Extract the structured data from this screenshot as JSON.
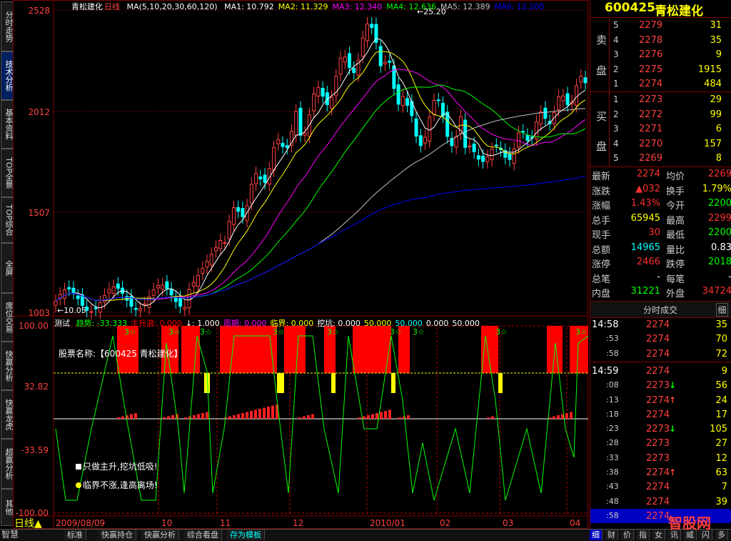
{
  "left_tabs": [
    {
      "label": "分时走势",
      "active": false
    },
    {
      "label": "技术分析",
      "active": true
    },
    {
      "label": "基本资料",
      "active": false
    },
    {
      "label": "TOP全景",
      "active": false
    },
    {
      "label": "TOP综合",
      "active": false
    },
    {
      "label": "全屏",
      "active": false
    },
    {
      "label": "席位交易",
      "active": false
    },
    {
      "label": "快赢分析",
      "active": false
    },
    {
      "label": "快赢龙虎",
      "active": false
    },
    {
      "label": "超赢分析",
      "active": false
    },
    {
      "label": "其他",
      "active": false
    }
  ],
  "main_chart": {
    "stock_name": "青松建化",
    "period": "日线",
    "ma_params": "MA(5,10,20,30,60,120)",
    "ma_values": [
      {
        "label": "MA1: 10.792",
        "color": "#ffffff"
      },
      {
        "label": "MA2: 11.329",
        "color": "#ffff00"
      },
      {
        "label": "MA3: 12.340",
        "color": "#ff00ff"
      },
      {
        "label": "MA4: 12.636",
        "color": "#00ff00"
      },
      {
        "label": "MA5: 12.389",
        "color": "#c0c0c0"
      },
      {
        "label": "MA6: 12.200",
        "color": "#0000ff"
      }
    ],
    "price_labels": [
      "2528",
      "2012",
      "1507",
      "1003"
    ],
    "peak_label": "25.20",
    "low_label": "10.05",
    "arrow_mark": "↓"
  },
  "indicator": {
    "name": "测试",
    "params": [
      {
        "text": "趋势: -33.333",
        "color": "#00ff00"
      },
      {
        "text": "主升浪: 0.000",
        "color": "#ff0000"
      },
      {
        "text": "↓: 1.000",
        "color": "#ffffff"
      },
      {
        "text": "周期: 0.000",
        "color": "#ff00ff"
      },
      {
        "text": "临界: 0.000",
        "color": "#ffff00"
      },
      {
        "text": "挖坑: 0.000",
        "color": "#ffffff"
      },
      {
        "text": "50.000",
        "color": "#ffff00"
      },
      {
        "text": "50.000",
        "color": "#00ffff"
      },
      {
        "text": "0.000",
        "color": "#ffffff"
      },
      {
        "text": "50.000",
        "color": "#ffffff"
      }
    ],
    "y_labels": [
      "100.00",
      "32.82",
      "-33.59",
      "-100.00"
    ],
    "stock_label": "股票名称:【600425 青松建化】",
    "note1": "只做主升,挖坑低吸!",
    "note2": "临界不涨,逢高离场!",
    "star": "3☆"
  },
  "x_axis": [
    "2009/08/09",
    "10",
    "11",
    "12",
    "2010/01",
    "02",
    "03",
    "04"
  ],
  "right_panel": {
    "code": "600425",
    "name": "青松建化",
    "sell_label": [
      "卖",
      "盘"
    ],
    "buy_label": [
      "买",
      "盘"
    ],
    "sell": [
      {
        "lvl": "5",
        "price": "2279",
        "vol": "31"
      },
      {
        "lvl": "4",
        "price": "2278",
        "vol": "35"
      },
      {
        "lvl": "3",
        "price": "2276",
        "vol": "9"
      },
      {
        "lvl": "2",
        "price": "2275",
        "vol": "1915"
      },
      {
        "lvl": "1",
        "price": "2274",
        "vol": "484"
      }
    ],
    "buy": [
      {
        "lvl": "1",
        "price": "2273",
        "vol": "29"
      },
      {
        "lvl": "2",
        "price": "2272",
        "vol": "99"
      },
      {
        "lvl": "3",
        "price": "2271",
        "vol": "6"
      },
      {
        "lvl": "4",
        "price": "2270",
        "vol": "157"
      },
      {
        "lvl": "5",
        "price": "2269",
        "vol": "8"
      }
    ],
    "quotes": [
      {
        "l1": "最新",
        "v1": "2274",
        "c1": "#ff3030",
        "l2": "均价",
        "v2": "2269",
        "c2": "#ff3030"
      },
      {
        "l1": "涨跌",
        "v1": "▲032",
        "c1": "#ff3030",
        "l2": "换手",
        "v2": "1.79%",
        "c2": "#ffff00"
      },
      {
        "l1": "涨幅",
        "v1": "1.43%",
        "c1": "#ff3030",
        "l2": "今开",
        "v2": "2200",
        "c2": "#00ff00"
      },
      {
        "l1": "总手",
        "v1": "65945",
        "c1": "#ffff00",
        "l2": "最高",
        "v2": "2299",
        "c2": "#ff3030"
      },
      {
        "l1": "现手",
        "v1": "30",
        "c1": "#ff3030",
        "l2": "最低",
        "v2": "2200",
        "c2": "#00ff00"
      },
      {
        "l1": "总额",
        "v1": "14965",
        "c1": "#00ffff",
        "l2": "量比",
        "v2": "0.83",
        "c2": "#ffffff"
      },
      {
        "l1": "涨停",
        "v1": "2466",
        "c1": "#ff3030",
        "l2": "跌停",
        "v2": "2018",
        "c2": "#00ff00"
      },
      {
        "l1": "总笔",
        "v1": "-",
        "c1": "#ffffff",
        "l2": "每笔",
        "v2": "-",
        "c2": "#ffffff"
      },
      {
        "l1": "内盘",
        "v1": "31221",
        "c1": "#00ff00",
        "l2": "外盘",
        "v2": "34724",
        "c2": "#ff3030"
      }
    ],
    "trades_title": "分时成交",
    "trades_tab": "细",
    "trades": [
      {
        "time": "14:58",
        "price": "2274",
        "arrow": "",
        "vol": "35"
      },
      {
        "time": ":53",
        "price": "2274",
        "arrow": "",
        "vol": "70"
      },
      {
        "time": ":58",
        "price": "2274",
        "arrow": "",
        "vol": "72"
      },
      {
        "time": "14:59",
        "price": "2274",
        "arrow": "",
        "vol": "9"
      },
      {
        "time": ":08",
        "price": "2273",
        "arrow": "↓",
        "vol": "56"
      },
      {
        "time": ":13",
        "price": "2274",
        "arrow": "↑",
        "vol": "24"
      },
      {
        "time": ":18",
        "price": "2274",
        "arrow": "",
        "vol": "17"
      },
      {
        "time": ":23",
        "price": "2273",
        "arrow": "↓",
        "vol": "105"
      },
      {
        "time": ":28",
        "price": "2273",
        "arrow": "",
        "vol": "27"
      },
      {
        "time": ":33",
        "price": "2273",
        "arrow": "",
        "vol": "12"
      },
      {
        "time": ":38",
        "price": "2274",
        "arrow": "↑",
        "vol": "63"
      },
      {
        "time": ":43",
        "price": "2274",
        "arrow": "",
        "vol": "7"
      },
      {
        "time": ":48",
        "price": "2274",
        "arrow": "",
        "vol": "39"
      },
      {
        "time": ":58",
        "price": "2274",
        "arrow": "",
        "vol": ""
      }
    ]
  },
  "bottom_bar": {
    "brand": "智慧",
    "tabs": [
      "标准",
      "快赢持仓",
      "快赢分析",
      "综合看盘",
      "存为模板"
    ],
    "right_tabs": [
      "细",
      "财",
      "价",
      "指",
      "女",
      "讯",
      "威",
      "闪",
      "多"
    ],
    "period_indicator": "日线▲",
    "watermark": "智股网"
  }
}
